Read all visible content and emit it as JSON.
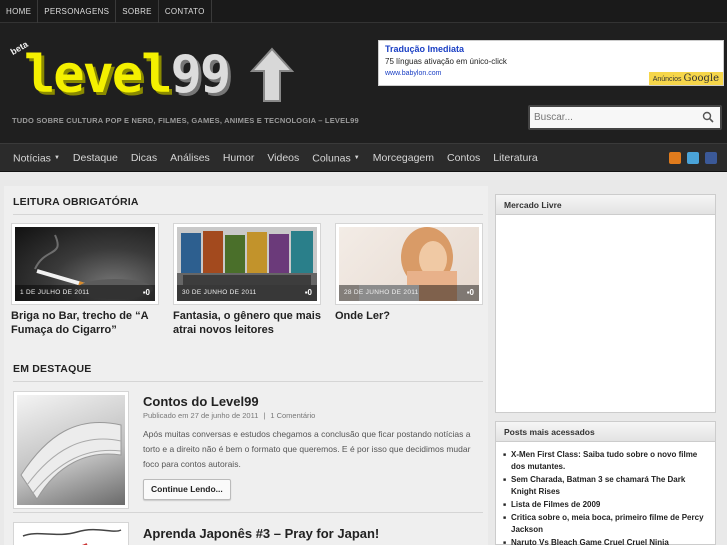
{
  "topbar": {
    "items": [
      "HOME",
      "PERSONAGENS",
      "SOBRE",
      "CONTATO"
    ]
  },
  "header": {
    "beta": "beta",
    "logo_left": "level",
    "logo_right": "99",
    "tagline": "TUDO SOBRE CULTURA POP E NERD, FILMES, GAMES, ANIMES E TECNOLOGIA – LEVEL99"
  },
  "ad": {
    "title": "Tradução Imediata",
    "description": "75 línguas ativação em único-click",
    "url": "www.babylon.com",
    "badge_prefix": "Anúncios",
    "badge_brand": "Google"
  },
  "search": {
    "placeholder": "Buscar..."
  },
  "nav": {
    "items": [
      "Notícias",
      "Destaque",
      "Dicas",
      "Análises",
      "Humor",
      "Videos",
      "Colunas",
      "Morcegagem",
      "Contos",
      "Literatura"
    ],
    "social_icons": [
      "rss-icon",
      "twitter-icon",
      "facebook-icon"
    ]
  },
  "main": {
    "must_read_heading": "LEITURA OBRIGATÓRIA",
    "cards": [
      {
        "date": "1 DE JULHO DE 2011",
        "comments": "0",
        "title": "Briga no Bar, trecho de “A Fumaça do Cigarro”"
      },
      {
        "date": "30 DE JUNHO DE 2011",
        "comments": "0",
        "title": "Fantasia, o gênero que mais atrai novos leitores"
      },
      {
        "date": "28 DE JUNHO DE 2011",
        "comments": "0",
        "title": "Onde Ler?"
      }
    ],
    "featured_heading": "EM DESTAQUE",
    "featured": [
      {
        "title": "Contos do Level99",
        "meta_published": "Publicado em 27 de junho de 2011",
        "meta_comments": "1 Comentário",
        "excerpt": "Após muitas conversas e estudos chegamos a conclusão que ficar postando notícias a torto e a direito não é bem o formato que queremos. E é por isso que decidimos mudar foco para contos autorais.",
        "button": "Continue Lendo..."
      },
      {
        "title": "Aprenda Japonês #3 – Pray for Japan!"
      }
    ]
  },
  "sidebar": {
    "mercado_title": "Mercado Livre",
    "popular_title": "Posts mais acessados",
    "popular_items": [
      "X-Men First Class: Saiba tudo sobre o novo filme dos mutantes.",
      "Sem Charada, Batman 3 se chamará The Dark Knight Rises",
      "Lista de Filmes de 2009",
      "Critica sobre o, meia boca, primeiro filme de Percy Jackson",
      "Naruto Vs Bleach Game Cruel Cruel Ninja"
    ]
  },
  "colors": {
    "header_bg": "#1f1f1f",
    "logo_yellow": "#f4f000",
    "nav_bg": "#2b2b2b",
    "page_bg": "#e9e9e9",
    "link_blue": "#1a3fc4"
  }
}
